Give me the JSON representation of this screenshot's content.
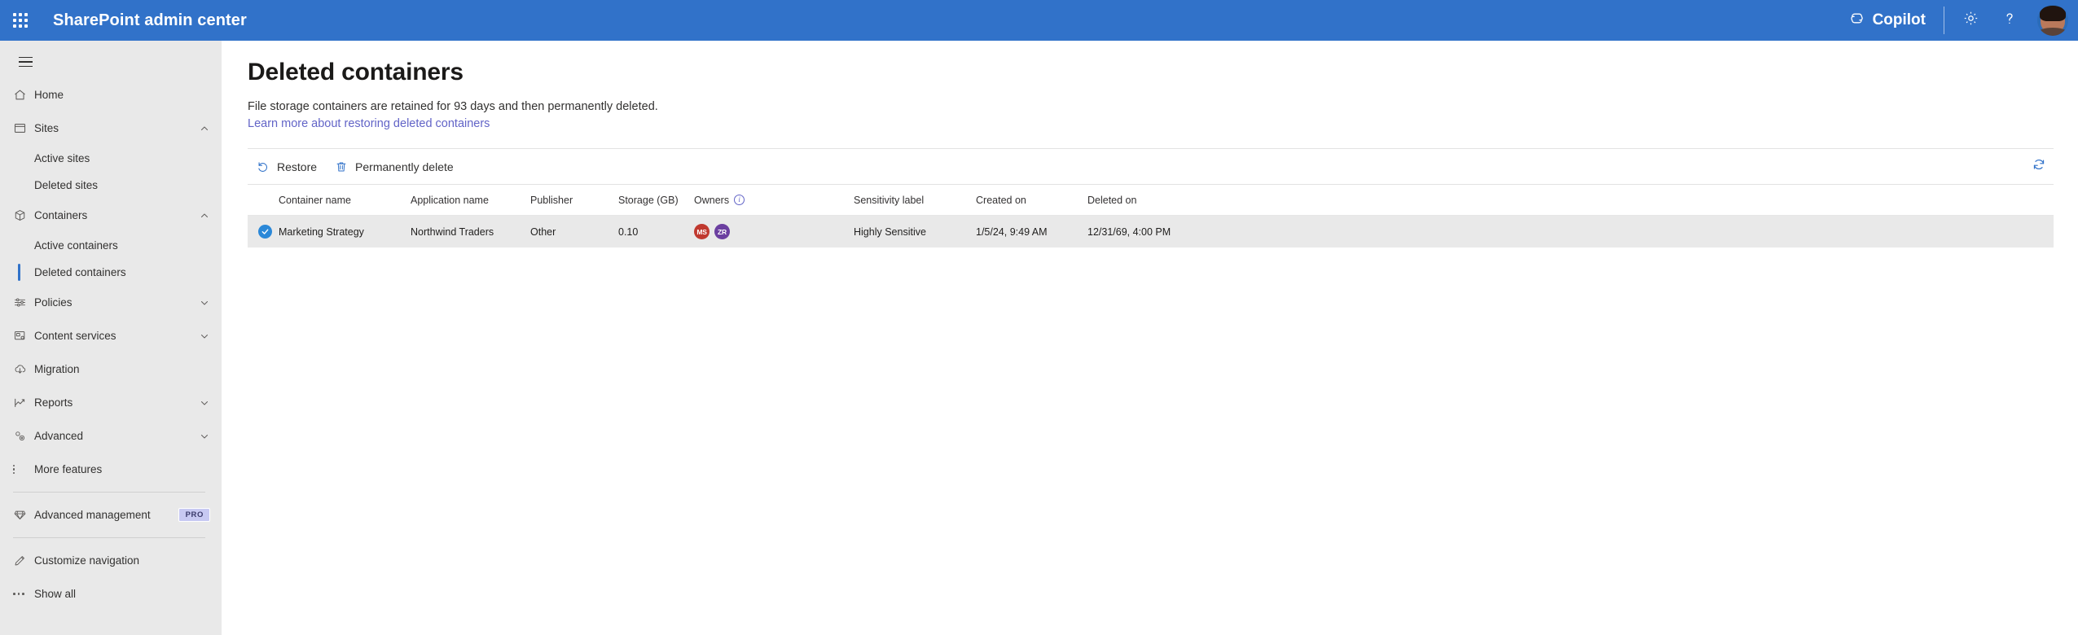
{
  "header": {
    "app_launcher_icon": "waffle-grid-icon",
    "title": "SharePoint admin center",
    "copilot_label": "Copilot",
    "copilot_icon": "copilot-icon",
    "settings_icon": "gear-icon",
    "help_icon": "question-mark-icon",
    "avatar_icon": "user-avatar",
    "brand_color": "#3172c9"
  },
  "sidebar": {
    "menu_toggle_icon": "hamburger-icon",
    "items": [
      {
        "label": "Home",
        "icon": "home-icon",
        "type": "item",
        "expandable": false
      },
      {
        "label": "Sites",
        "icon": "sites-icon",
        "type": "item",
        "expandable": true,
        "expanded": true
      },
      {
        "label": "Active sites",
        "type": "sub",
        "selected": false
      },
      {
        "label": "Deleted sites",
        "type": "sub",
        "selected": false
      },
      {
        "label": "Containers",
        "icon": "containers-icon",
        "type": "item",
        "expandable": true,
        "expanded": true
      },
      {
        "label": "Active containers",
        "type": "sub",
        "selected": false
      },
      {
        "label": "Deleted containers",
        "type": "sub",
        "selected": true
      },
      {
        "label": "Policies",
        "icon": "policies-icon",
        "type": "item",
        "expandable": true,
        "expanded": false
      },
      {
        "label": "Content services",
        "icon": "content-services-icon",
        "type": "item",
        "expandable": true,
        "expanded": false
      },
      {
        "label": "Migration",
        "icon": "migration-icon",
        "type": "item",
        "expandable": false
      },
      {
        "label": "Reports",
        "icon": "reports-icon",
        "type": "item",
        "expandable": true,
        "expanded": false
      },
      {
        "label": "Advanced",
        "icon": "advanced-icon",
        "type": "item",
        "expandable": true,
        "expanded": false
      },
      {
        "label": "More features",
        "icon": "more-features-icon",
        "type": "item",
        "expandable": false
      }
    ],
    "advanced_management": {
      "label": "Advanced management",
      "icon": "diamond-icon",
      "badge": "PRO"
    },
    "customize_navigation": {
      "label": "Customize navigation",
      "icon": "pencil-icon"
    },
    "show_all": {
      "label": "Show all",
      "icon": "ellipsis-icon"
    },
    "selected_accent_color": "#3172c9"
  },
  "page": {
    "title": "Deleted containers",
    "description": "File storage containers are retained for 93 days and then permanently deleted.",
    "link_text": "Learn more about restoring deleted containers",
    "link_color": "#6264c7"
  },
  "toolbar": {
    "restore_label": "Restore",
    "restore_icon": "undo-arrow-icon",
    "delete_label": "Permanently delete",
    "delete_icon": "trash-icon",
    "refresh_icon": "refresh-icon",
    "icon_color": "#3172c9"
  },
  "table": {
    "columns": [
      "Container name",
      "Application name",
      "Publisher",
      "Storage (GB)",
      "Owners",
      "Sensitivity label",
      "Created on",
      "Deleted on"
    ],
    "owners_info_icon": "info-icon",
    "rows": [
      {
        "selected": true,
        "select_icon": "checkmark-circle-icon",
        "container_name": "Marketing Strategy",
        "application_name": "Northwind Traders",
        "publisher": "Other",
        "storage_gb": "0.10",
        "owners": [
          {
            "initials": "MS",
            "color": "#c0392f"
          },
          {
            "initials": "ZR",
            "color": "#6b3fa0"
          }
        ],
        "sensitivity_label": "Highly Sensitive",
        "created_on": "1/5/24, 9:49 AM",
        "deleted_on": "12/31/69, 4:00 PM"
      }
    ]
  }
}
